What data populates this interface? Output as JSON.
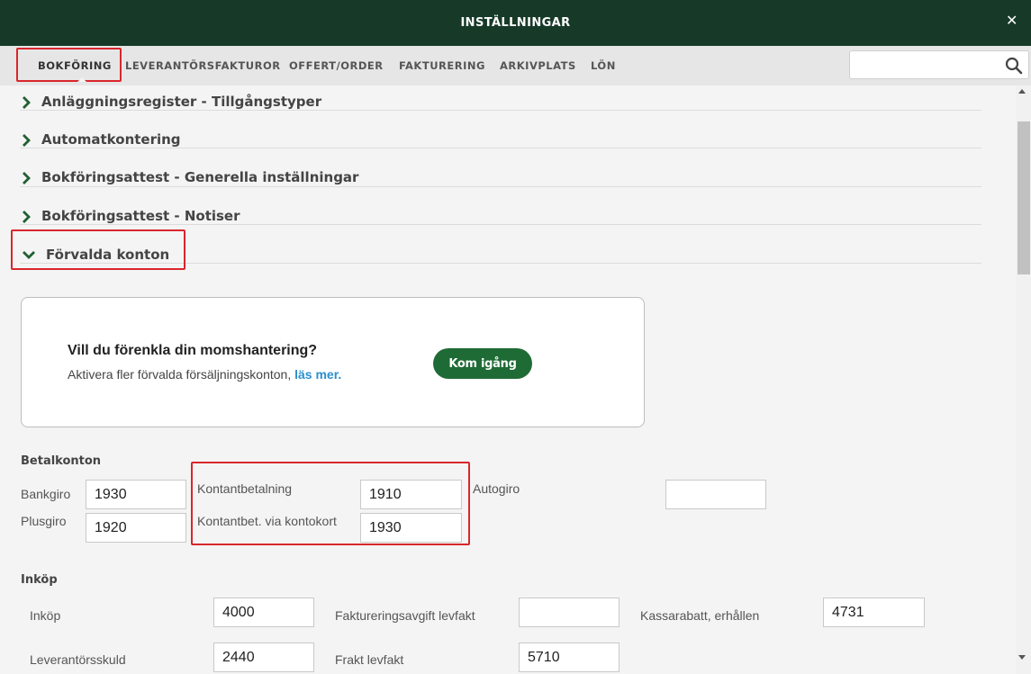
{
  "header": {
    "title": "INSTÄLLNINGAR"
  },
  "tabs": [
    {
      "label": "BOKFÖRING"
    },
    {
      "label": "LEVERANTÖRSFAKTUROR"
    },
    {
      "label": "OFFERT/ORDER"
    },
    {
      "label": "FAKTURERING"
    },
    {
      "label": "ARKIVPLATS"
    },
    {
      "label": "LÖN"
    }
  ],
  "search": {
    "value": "",
    "placeholder": ""
  },
  "accordion": [
    {
      "label": "Anläggningsregister - Tillgångstyper",
      "expanded": false
    },
    {
      "label": "Automatkontering",
      "expanded": false
    },
    {
      "label": "Bokföringsattest - Generella inställningar",
      "expanded": false
    },
    {
      "label": "Bokföringsattest - Notiser",
      "expanded": false
    },
    {
      "label": "Förvalda konton",
      "expanded": true
    }
  ],
  "promo": {
    "title": "Vill du förenkla din momshantering?",
    "text": "Aktivera fler förvalda försäljningskonton,",
    "link": "läs mer.",
    "button": "Kom igång"
  },
  "betalkonton": {
    "title": "Betalkonton",
    "bankgiro": {
      "label": "Bankgiro",
      "value": "1930"
    },
    "plusgiro": {
      "label": "Plusgiro",
      "value": "1920"
    },
    "kontantbetalning": {
      "label": "Kontantbetalning",
      "value": "1910"
    },
    "kontokort": {
      "label": "Kontantbet. via kontokort",
      "value": "1930"
    },
    "autogiro": {
      "label": "Autogiro",
      "value": ""
    }
  },
  "inkop": {
    "title": "Inköp",
    "inkop": {
      "label": "Inköp",
      "value": "4000"
    },
    "faktureringsavgift": {
      "label": "Faktureringsavgift levfakt",
      "value": ""
    },
    "kassarabatt": {
      "label": "Kassarabatt, erhållen",
      "value": "4731"
    },
    "leverantorsskuld": {
      "label": "Leverantörsskuld",
      "value": "2440"
    },
    "frakt": {
      "label": "Frakt levfakt",
      "value": "5710"
    }
  },
  "colors": {
    "header": "#173a28",
    "accent": "#1f6b35",
    "link": "#2a8fcf",
    "highlight": "#d9262c"
  }
}
